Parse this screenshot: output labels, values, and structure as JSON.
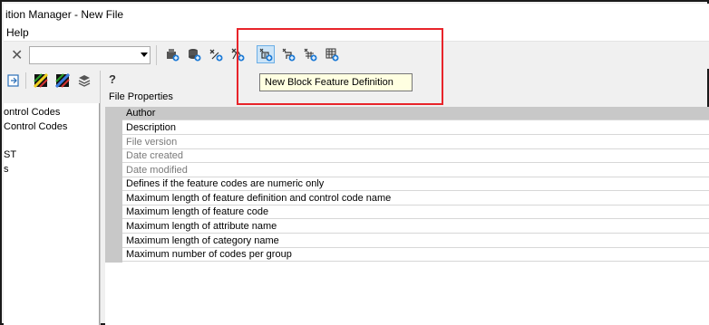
{
  "window": {
    "title": "ition Manager - New File"
  },
  "menu": {
    "items": [
      "Help"
    ]
  },
  "toolbar": {
    "combo_value": "",
    "buttons": [
      {
        "name": "import-icon"
      },
      {
        "name": "database-add-icon"
      },
      {
        "name": "feature-add-icon"
      },
      {
        "name": "line-feature-icon"
      },
      {
        "name": "block-feature-icon"
      },
      {
        "name": "attribute-feature-icon"
      },
      {
        "name": "grid-add-icon"
      },
      {
        "name": "table-add-icon"
      }
    ],
    "tooltip": "New Block Feature Definition",
    "highlight_color": "#e8242a"
  },
  "left_toolbar": {
    "help_label": "?"
  },
  "tree": {
    "items": [
      "ontrol Codes",
      "Control Codes",
      "ST",
      "s"
    ]
  },
  "properties": {
    "section_label": "File Properties",
    "rows": [
      {
        "label": "Author",
        "muted": false
      },
      {
        "label": "Description",
        "muted": false
      },
      {
        "label": "File version",
        "muted": true
      },
      {
        "label": "Date created",
        "muted": true
      },
      {
        "label": "Date modified",
        "muted": true
      },
      {
        "label": "Defines if the feature codes are numeric only",
        "muted": false
      },
      {
        "label": "Maximum length of feature definition and control code name",
        "muted": false
      },
      {
        "label": "Maximum length of feature code",
        "muted": false
      },
      {
        "label": "Maximum length of attribute name",
        "muted": false
      },
      {
        "label": "Maximum length of category name",
        "muted": false
      },
      {
        "label": "Maximum number of codes per group",
        "muted": false
      }
    ]
  }
}
